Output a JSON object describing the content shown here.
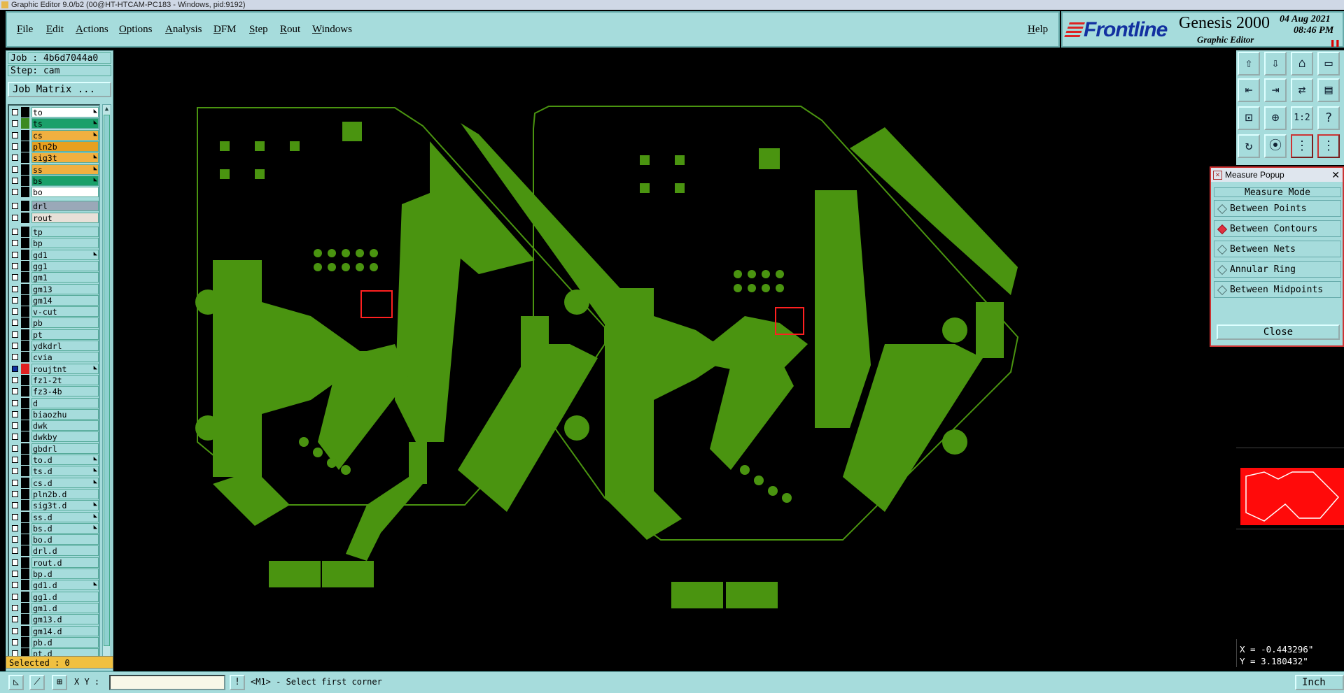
{
  "window": {
    "title": "Graphic Editor 9.0/b2 (00@HT-HTCAM-PC183 - Windows, pid:9192)"
  },
  "menu": {
    "items": [
      "File",
      "Edit",
      "Actions",
      "Options",
      "Analysis",
      "DFM",
      "Step",
      "Rout",
      "Windows"
    ],
    "help": "Help"
  },
  "header": {
    "brand": "Frontline",
    "product": "Genesis 2000",
    "subtitle": "Graphic Editor",
    "date": "04 Aug 2021",
    "time": "08:46 PM",
    "pause_icon": "pause-icon"
  },
  "job": {
    "job_label": "Job : 4b6d7044a0",
    "step_label": "Step: cam",
    "matrix_button": "Job Matrix ..."
  },
  "layers": [
    {
      "name": "to",
      "color": "#ffffff",
      "swatch": "#000000",
      "arrow": true
    },
    {
      "name": "ts",
      "color": "#1aa06a",
      "swatch": "#3a8a20",
      "arrow": true
    },
    {
      "name": "cs",
      "color": "#f0b040",
      "swatch": "#000000",
      "arrow": true
    },
    {
      "name": "pln2b",
      "color": "#e8a020",
      "swatch": "#000000",
      "arrow": false
    },
    {
      "name": "sig3t",
      "color": "#f0b040",
      "swatch": "#000000",
      "arrow": true
    },
    {
      "name": "ss",
      "color": "#f0b040",
      "swatch": "#000000",
      "arrow": true
    },
    {
      "name": "bs",
      "color": "#1aa06a",
      "swatch": "#000000",
      "arrow": true
    },
    {
      "name": "bo",
      "color": "#ffffff",
      "swatch": "#000000",
      "arrow": false
    },
    {
      "name": "drl",
      "color": "#9aa8b8",
      "swatch": "#000000",
      "arrow": false
    },
    {
      "name": "rout",
      "color": "#e8e0d8",
      "swatch": "#000000",
      "arrow": false
    },
    {
      "name": "tp",
      "color": "#a6dcdc",
      "swatch": "#000000",
      "arrow": false
    },
    {
      "name": "bp",
      "color": "#a6dcdc",
      "swatch": "#000000",
      "arrow": false
    },
    {
      "name": "gd1",
      "color": "#a6dcdc",
      "swatch": "#000000",
      "arrow": true
    },
    {
      "name": "gg1",
      "color": "#a6dcdc",
      "swatch": "#000000",
      "arrow": false
    },
    {
      "name": "gm1",
      "color": "#a6dcdc",
      "swatch": "#000000",
      "arrow": false
    },
    {
      "name": "gm13",
      "color": "#a6dcdc",
      "swatch": "#000000",
      "arrow": false
    },
    {
      "name": "gm14",
      "color": "#a6dcdc",
      "swatch": "#000000",
      "arrow": false
    },
    {
      "name": "v-cut",
      "color": "#a6dcdc",
      "swatch": "#000000",
      "arrow": false
    },
    {
      "name": "pb",
      "color": "#a6dcdc",
      "swatch": "#000000",
      "arrow": false
    },
    {
      "name": "pt",
      "color": "#a6dcdc",
      "swatch": "#000000",
      "arrow": false
    },
    {
      "name": "ydkdrl",
      "color": "#a6dcdc",
      "swatch": "#000000",
      "arrow": false
    },
    {
      "name": "cvia",
      "color": "#a6dcdc",
      "swatch": "#000000",
      "arrow": false
    },
    {
      "name": "roujtnt",
      "color": "#a6dcdc",
      "swatch": "#e02020",
      "arrow": true,
      "active": true
    },
    {
      "name": "fz1-2t",
      "color": "#a6dcdc",
      "swatch": "#000000",
      "arrow": false
    },
    {
      "name": "fz3-4b",
      "color": "#a6dcdc",
      "swatch": "#000000",
      "arrow": false
    },
    {
      "name": "d",
      "color": "#a6dcdc",
      "swatch": "#000000",
      "arrow": false
    },
    {
      "name": "biaozhu",
      "color": "#a6dcdc",
      "swatch": "#000000",
      "arrow": false
    },
    {
      "name": "dwk",
      "color": "#a6dcdc",
      "swatch": "#000000",
      "arrow": false
    },
    {
      "name": "dwkby",
      "color": "#a6dcdc",
      "swatch": "#000000",
      "arrow": false
    },
    {
      "name": "gbdrl",
      "color": "#a6dcdc",
      "swatch": "#000000",
      "arrow": false
    },
    {
      "name": "to.d",
      "color": "#a6dcdc",
      "swatch": "#000000",
      "arrow": true
    },
    {
      "name": "ts.d",
      "color": "#a6dcdc",
      "swatch": "#000000",
      "arrow": true
    },
    {
      "name": "cs.d",
      "color": "#a6dcdc",
      "swatch": "#000000",
      "arrow": true
    },
    {
      "name": "pln2b.d",
      "color": "#a6dcdc",
      "swatch": "#000000",
      "arrow": false
    },
    {
      "name": "sig3t.d",
      "color": "#a6dcdc",
      "swatch": "#000000",
      "arrow": true
    },
    {
      "name": "ss.d",
      "color": "#a6dcdc",
      "swatch": "#000000",
      "arrow": true
    },
    {
      "name": "bs.d",
      "color": "#a6dcdc",
      "swatch": "#000000",
      "arrow": true
    },
    {
      "name": "bo.d",
      "color": "#a6dcdc",
      "swatch": "#000000",
      "arrow": false
    },
    {
      "name": "drl.d",
      "color": "#a6dcdc",
      "swatch": "#000000",
      "arrow": false
    },
    {
      "name": "rout.d",
      "color": "#a6dcdc",
      "swatch": "#000000",
      "arrow": false
    },
    {
      "name": "bp.d",
      "color": "#a6dcdc",
      "swatch": "#000000",
      "arrow": false
    },
    {
      "name": "gd1.d",
      "color": "#a6dcdc",
      "swatch": "#000000",
      "arrow": true
    },
    {
      "name": "gg1.d",
      "color": "#a6dcdc",
      "swatch": "#000000",
      "arrow": false
    },
    {
      "name": "gm1.d",
      "color": "#a6dcdc",
      "swatch": "#000000",
      "arrow": false
    },
    {
      "name": "gm13.d",
      "color": "#a6dcdc",
      "swatch": "#000000",
      "arrow": false
    },
    {
      "name": "gm14.d",
      "color": "#a6dcdc",
      "swatch": "#000000",
      "arrow": false
    },
    {
      "name": "pb.d",
      "color": "#a6dcdc",
      "swatch": "#000000",
      "arrow": false
    },
    {
      "name": "pt.d",
      "color": "#a6dcdc",
      "swatch": "#000000",
      "arrow": false
    }
  ],
  "status": {
    "selected": "Selected : 0"
  },
  "tools": [
    "home-icon",
    "save-icon",
    "house-icon",
    "panel-icon",
    "import-icon",
    "export-icon",
    "swap-icon",
    "layout-icon",
    "fit-icon",
    "zoom-icon",
    "1:2",
    "?",
    "rotate-icon",
    "snap-icon",
    "net-icon",
    "net-alt-icon"
  ],
  "measure": {
    "title": "Measure Popup",
    "mode_label": "Measure Mode",
    "options": [
      "Between Points",
      "Between Contours",
      "Between Nets",
      "Annular Ring",
      "Between Midpoints"
    ],
    "selected": "Between Contours",
    "close": "Close"
  },
  "coords": {
    "x": "X = -0.443296\"",
    "y": "Y = 3.180432\""
  },
  "bottom": {
    "xy_label": "X Y :",
    "xy_value": "",
    "prompt": "<M1> - Select first corner",
    "unit": "Inch"
  },
  "colors": {
    "copper": "#4a9410",
    "highlight": "#ff2020",
    "panel": "#a6dcdc",
    "thumb": "#ff0a0a"
  }
}
